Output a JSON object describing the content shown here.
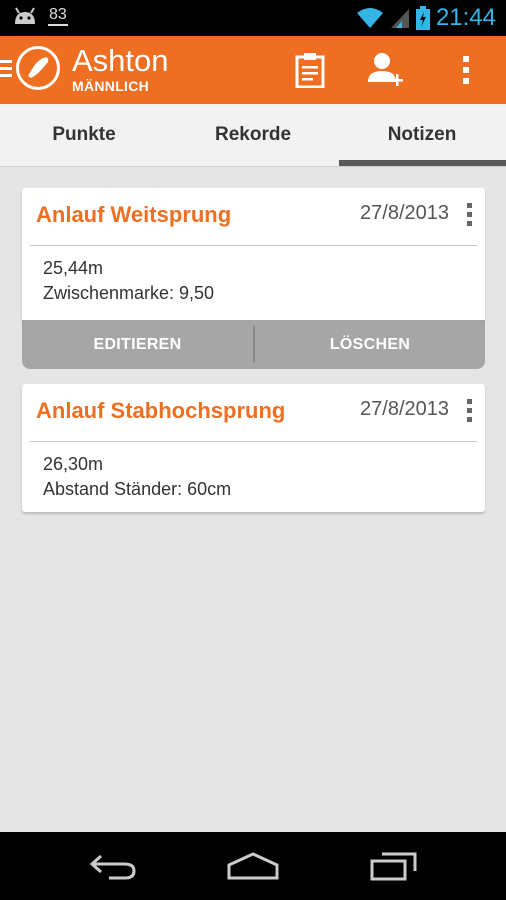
{
  "status_bar": {
    "notification_count": "83",
    "time": "21:44",
    "icons": [
      "android-icon",
      "wifi-icon",
      "signal-icon",
      "battery-charging-icon"
    ]
  },
  "action_bar": {
    "title": "Ashton",
    "subtitle": "MÄNNLICH",
    "icons": [
      "drawer-icon",
      "shoe-logo-icon",
      "clipboard-icon",
      "add-person-icon",
      "overflow-menu-icon"
    ],
    "color": "#ee6f22"
  },
  "tabs": [
    {
      "label": "Punkte",
      "selected": false
    },
    {
      "label": "Rekorde",
      "selected": false
    },
    {
      "label": "Notizen",
      "selected": true
    }
  ],
  "notes": [
    {
      "title": "Anlauf Weitsprung",
      "date": "27/8/2013",
      "lines": [
        "25,44m",
        "Zwischenmarke: 9,50"
      ],
      "actions": [
        "EDITIEREN",
        "LÖSCHEN"
      ]
    },
    {
      "title": "Anlauf Stabhochsprung",
      "date": "27/8/2013",
      "lines": [
        "26,30m",
        "Abstand Ständer: 60cm"
      ]
    }
  ],
  "nav_bar": {
    "icons": [
      "back-icon",
      "home-icon",
      "recent-apps-icon"
    ]
  }
}
